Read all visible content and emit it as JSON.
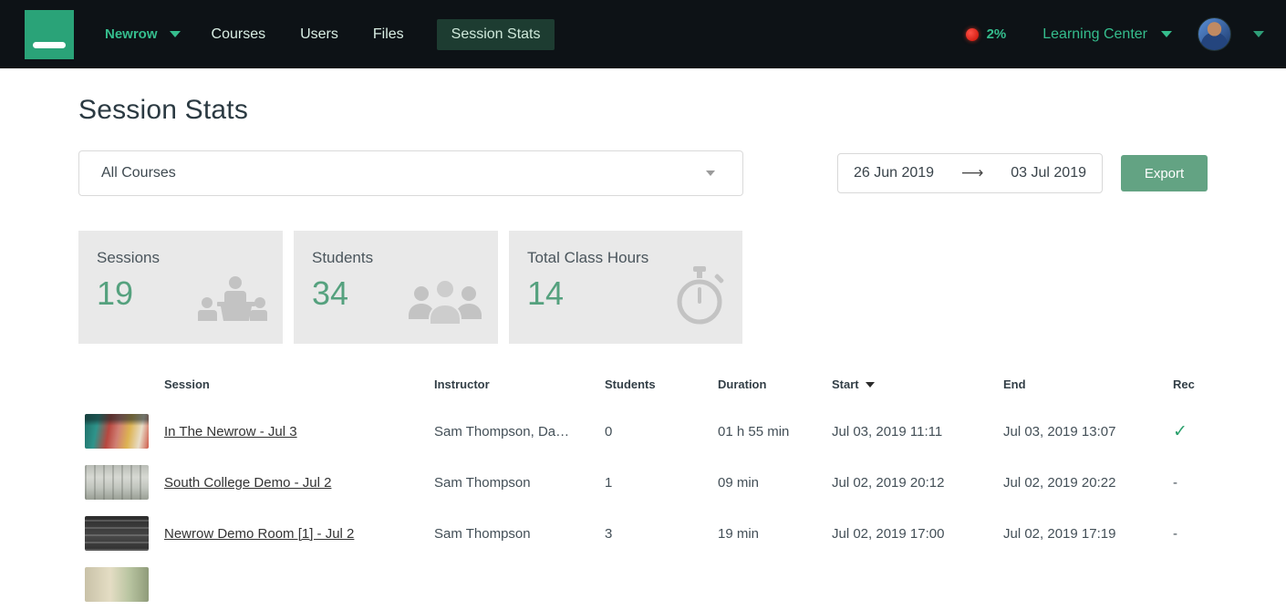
{
  "navbar": {
    "brand": "Newrow",
    "items": [
      {
        "label": "Courses"
      },
      {
        "label": "Users"
      },
      {
        "label": "Files"
      },
      {
        "label": "Session Stats"
      }
    ],
    "status_percent": "2%",
    "learning_center_label": "Learning Center"
  },
  "page": {
    "title": "Session Stats"
  },
  "filters": {
    "course_select_value": "All Courses",
    "date_from": "26 Jun 2019",
    "date_arrow": "⟶",
    "date_to": "03 Jul 2019",
    "export_label": "Export"
  },
  "stats": [
    {
      "label": "Sessions",
      "value": "19",
      "icon": "presenter-audience-icon"
    },
    {
      "label": "Students",
      "value": "34",
      "icon": "students-group-icon"
    },
    {
      "label": "Total Class Hours",
      "value": "14",
      "icon": "stopwatch-icon"
    }
  ],
  "table": {
    "columns": {
      "session": "Session",
      "instructor": "Instructor",
      "students": "Students",
      "duration": "Duration",
      "start": "Start",
      "end": "End",
      "rec": "Rec"
    },
    "rows": [
      {
        "session": "In The Newrow - Jul 3",
        "instructor": "Sam Thompson, Da…",
        "students": "0",
        "duration": "01 h 55 min",
        "start": "Jul 03, 2019 11:11",
        "end": "Jul 03, 2019 13:07",
        "rec": "✓"
      },
      {
        "session": "South College Demo - Jul 2",
        "instructor": "Sam Thompson",
        "students": "1",
        "duration": "09 min",
        "start": "Jul 02, 2019 20:12",
        "end": "Jul 02, 2019 20:22",
        "rec": "-"
      },
      {
        "session": "Newrow Demo Room [1] - Jul 2",
        "instructor": "Sam Thompson",
        "students": "3",
        "duration": "19 min",
        "start": "Jul 02, 2019 17:00",
        "end": "Jul 02, 2019 17:19",
        "rec": "-"
      }
    ]
  },
  "colors": {
    "accent_teal": "#35bd8d",
    "navbar_bg": "#0d1216",
    "active_nav_bg": "#1d3c31",
    "logo_green": "#2aa378",
    "export_green": "#63a383",
    "stat_number_green": "#55a17e",
    "card_bg": "#e9e9e9",
    "record_red": "#e02b20",
    "check_green": "#2aa06c"
  }
}
